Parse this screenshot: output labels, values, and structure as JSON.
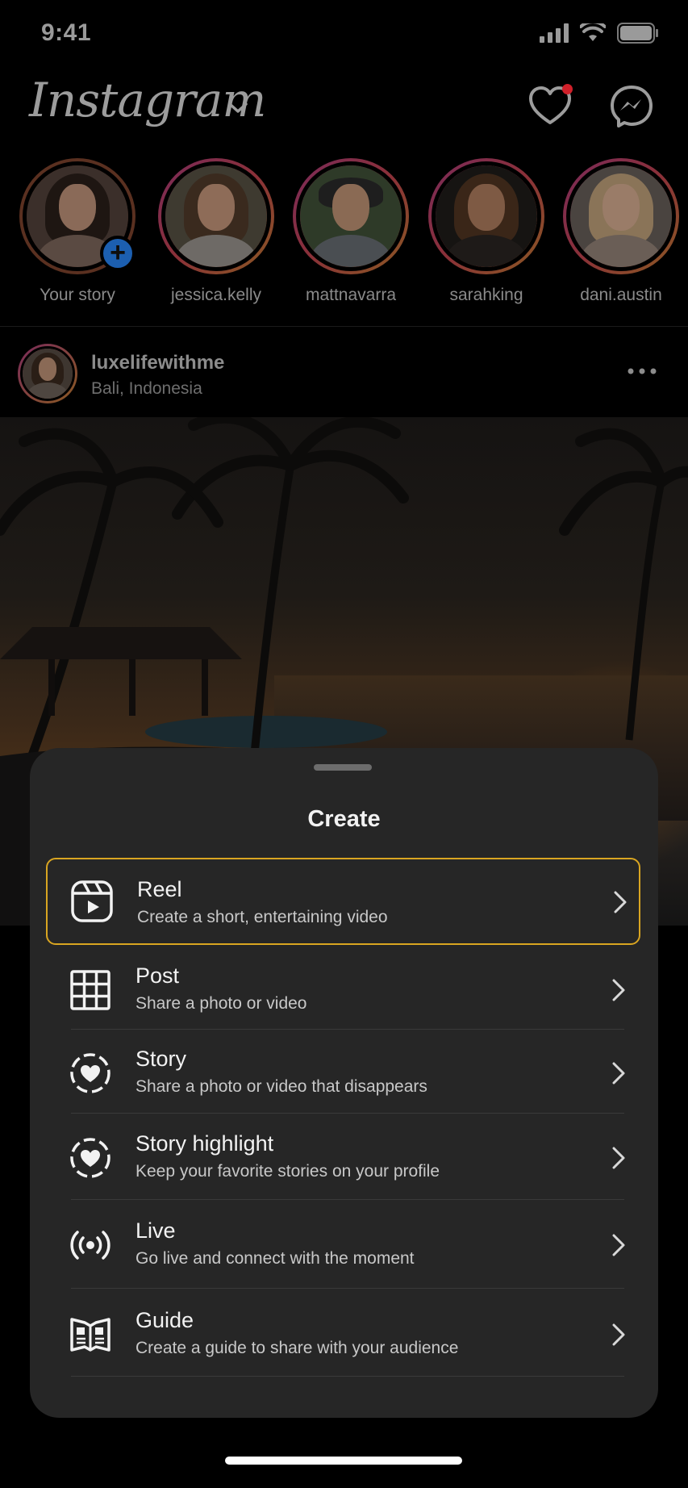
{
  "status_bar": {
    "time": "9:41"
  },
  "header": {
    "logo": "Instagram",
    "icons": [
      "chevron-down-icon",
      "heart-icon",
      "messenger-icon"
    ],
    "notification_color": "#d0202a"
  },
  "stories": [
    {
      "label": "Your story",
      "own": true
    },
    {
      "label": "jessica.kelly"
    },
    {
      "label": "mattnavarra"
    },
    {
      "label": "sarahking"
    },
    {
      "label": "dani.austin"
    }
  ],
  "post": {
    "username": "luxelifewithme",
    "location": "Bali, Indonesia"
  },
  "sheet": {
    "title": "Create",
    "selected_color": "#d9a521",
    "options": [
      {
        "title": "Reel",
        "subtitle": "Create a short, entertaining video",
        "icon": "reel-icon"
      },
      {
        "title": "Post",
        "subtitle": "Share a photo or video",
        "icon": "grid-icon"
      },
      {
        "title": "Story",
        "subtitle": "Share a photo or video that disappears",
        "icon": "story-icon"
      },
      {
        "title": "Story highlight",
        "subtitle": "Keep your favorite stories on your profile",
        "icon": "story-highlight-icon"
      },
      {
        "title": "Live",
        "subtitle": "Go live and connect with the moment",
        "icon": "live-icon"
      },
      {
        "title": "Guide",
        "subtitle": "Create a guide to share with your audience",
        "icon": "guide-icon"
      }
    ]
  }
}
